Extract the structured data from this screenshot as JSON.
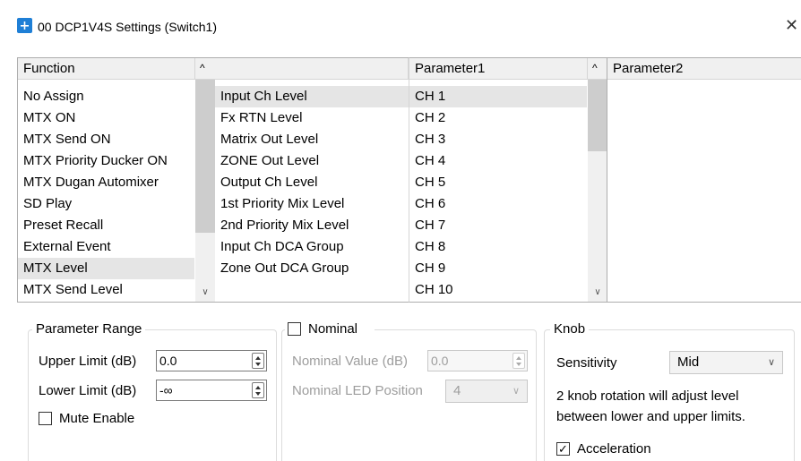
{
  "window": {
    "title": "00 DCP1V4S Settings (Switch1)",
    "close_glyph": "✕"
  },
  "function_list": {
    "header": "Function",
    "items": [
      "No Assign",
      "MTX ON",
      "MTX Send ON",
      "MTX Priority Ducker ON",
      "MTX Dugan Automixer",
      "SD Play",
      "Preset Recall",
      "External Event",
      "MTX Level",
      "MTX Send Level"
    ],
    "selected": "MTX Level"
  },
  "sub_list": {
    "items": [
      "Input Ch Level",
      "Fx RTN Level",
      "Matrix Out Level",
      "ZONE Out Level",
      "Output Ch Level",
      "1st Priority Mix Level",
      "2nd Priority Mix Level",
      "Input Ch DCA Group",
      "Zone Out DCA Group"
    ],
    "selected": "Input Ch Level"
  },
  "parameter1": {
    "header": "Parameter1",
    "items": [
      "CH 1",
      "CH 2",
      "CH 3",
      "CH 4",
      "CH 5",
      "CH 6",
      "CH 7",
      "CH 8",
      "CH 9",
      "CH 10"
    ],
    "selected": "CH 1"
  },
  "parameter2": {
    "header": "Parameter2"
  },
  "parameter_range": {
    "title": "Parameter Range",
    "upper_label": "Upper Limit (dB)",
    "upper_value": "0.0",
    "lower_label": "Lower Limit (dB)",
    "lower_value": "-∞",
    "mute_label": "Mute Enable",
    "mute_checked": false
  },
  "nominal": {
    "title": "Nominal",
    "checked": false,
    "value_label": "Nominal Value (dB)",
    "value": "0.0",
    "led_label": "Nominal LED Position",
    "led_value": "4"
  },
  "knob": {
    "title": "Knob",
    "sensitivity_label": "Sensitivity",
    "sensitivity_value": "Mid",
    "info_line1": "2 knob rotation will adjust level",
    "info_line2": "between lower and upper limits.",
    "acceleration_label": "Acceleration",
    "acceleration_checked": true,
    "check_glyph": "✓"
  },
  "colors": {
    "accent": "#1f7fd6",
    "selection": "#e5e5e5",
    "header_bg": "#f0f0f0"
  }
}
